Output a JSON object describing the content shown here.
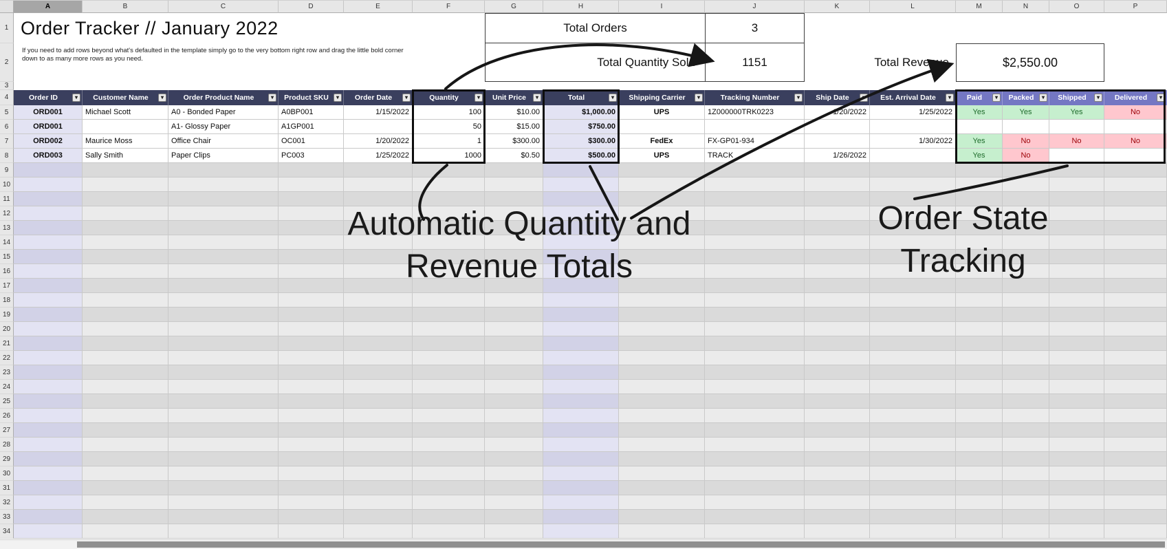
{
  "colors": {
    "header-bg": "#3A3F5E",
    "status-header-bg": "#7477C3",
    "lavender": "#E3E3F3",
    "lavender-band": "#D2D2E7",
    "band": "#DADADA",
    "band-light": "#EBEBEB",
    "grid-line": "#C9C9C9",
    "yes-bg": "#C6EFCE",
    "yes-text": "#1D6B2A",
    "no-bg": "#FFC7CE",
    "no-text": "#9C0006"
  },
  "chrome": {
    "column_letters": [
      "A",
      "B",
      "C",
      "D",
      "E",
      "F",
      "G",
      "H",
      "I",
      "J",
      "K",
      "L",
      "M",
      "N",
      "O",
      "P"
    ],
    "row_numbers": [
      "1",
      "2",
      "3",
      "4",
      "5",
      "6",
      "7",
      "8",
      "9",
      "10",
      "11",
      "12",
      "13",
      "14",
      "15",
      "16",
      "17",
      "18",
      "19",
      "20",
      "21",
      "22",
      "23",
      "24",
      "25",
      "26",
      "27",
      "28",
      "29",
      "30",
      "31",
      "32",
      "33",
      "34"
    ],
    "filter_icon": "▾"
  },
  "header": {
    "title": "Order Tracker // January 2022",
    "instructions_line1": "If you need to add rows beyond what's defaulted in the template simply go to the very bottom right row and drag the little bold corner",
    "instructions_line2": "down to as many more rows as you need.",
    "total_orders_label": "Total Orders",
    "total_orders_value": "3",
    "total_quantity_label": "Total Quantity Sold",
    "total_quantity_value": "1151",
    "total_revenue_label": "Total Revenue",
    "total_revenue_value": "$2,550.00"
  },
  "table": {
    "headers": [
      "Order ID",
      "Customer Name",
      "Order Product Name",
      "Product SKU",
      "Order Date",
      "Quantity",
      "Unit Price",
      "Total",
      "Shipping Carrier",
      "Tracking Number",
      "Ship Date",
      "Est. Arrival Date",
      "Paid",
      "Packed",
      "Shipped",
      "Delivered"
    ],
    "rows": [
      {
        "id": "ORD001",
        "customer": "Michael Scott",
        "product": "A0 - Bonded Paper",
        "sku": "A0BP001",
        "order_date": "1/15/2022",
        "qty": "100",
        "unit_price": "$10.00",
        "total": "$1,000.00",
        "carrier": "UPS",
        "tracking": "1Z000000TRK0223",
        "ship_date": "1/20/2022",
        "arrival": "1/25/2022",
        "paid": "Yes",
        "packed": "Yes",
        "shipped": "Yes",
        "delivered": "No"
      },
      {
        "id": "ORD001",
        "customer": "",
        "product": "A1- Glossy Paper",
        "sku": "A1GP001",
        "order_date": "",
        "qty": "50",
        "unit_price": "$15.00",
        "total": "$750.00",
        "carrier": "",
        "tracking": "",
        "ship_date": "",
        "arrival": "",
        "paid": "",
        "packed": "",
        "shipped": "",
        "delivered": ""
      },
      {
        "id": "ORD002",
        "customer": "Maurice Moss",
        "product": "Office Chair",
        "sku": "OC001",
        "order_date": "1/20/2022",
        "qty": "1",
        "unit_price": "$300.00",
        "total": "$300.00",
        "carrier": "FedEx",
        "tracking": "FX-GP01-934",
        "ship_date": "",
        "arrival": "1/30/2022",
        "paid": "Yes",
        "packed": "No",
        "shipped": "No",
        "delivered": "No"
      },
      {
        "id": "ORD003",
        "customer": "Sally Smith",
        "product": "Paper Clips",
        "sku": "PC003",
        "order_date": "1/25/2022",
        "qty": "1000",
        "unit_price": "$0.50",
        "total": "$500.00",
        "carrier": "UPS",
        "tracking": "TRACK",
        "ship_date": "1/26/2022",
        "arrival": "",
        "paid": "Yes",
        "packed": "No",
        "shipped": "",
        "delivered": ""
      }
    ]
  },
  "annotations": {
    "totals_note_line1": "Automatic Quantity and",
    "totals_note_line2": "Revenue Totals",
    "state_note_line1": "Order State",
    "state_note_line2": "Tracking"
  }
}
